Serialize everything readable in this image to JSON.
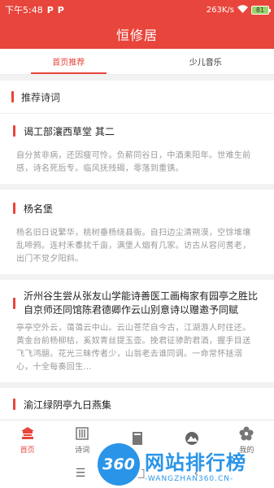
{
  "status": {
    "time": "下午5:48",
    "left_icons": [
      "P",
      "P"
    ],
    "network_speed": "263K/s",
    "battery": "81"
  },
  "app": {
    "title": "恒修居"
  },
  "tabs": [
    {
      "label": "首页推荐",
      "active": true
    },
    {
      "label": "少儿音乐",
      "active": false
    }
  ],
  "section": {
    "title": "推荐诗词"
  },
  "poems": [
    {
      "title": "谒工部瀼西草堂 其二",
      "snippet": "自分贫非病，还因瘦可怜。负薪同谷日，中酒耒阳年。世难生前感，诗名死后专。临风抚残碣，零落到重镌。"
    },
    {
      "title": "杨名堡",
      "snippet": "杨名旧日说繁华，桃树垂杨绕县衙。自扫边尘清朔漠，空馀堆壤乱啼鸦。连村禾黍扰千亩，满堡人烟有几家。访古从容问耆老，出门不觉夕阳斜。"
    },
    {
      "title": "沂州谷生尝从张友山学能诗善医工画梅家有园亭之胜比自京师还同馆陈君德卿作云山别意诗以赠邀予同赋",
      "snippet": "亭亭空外云，蔼蔼云中山。云山苍茫自今古，江湖游人时往还。黄金台前杨柳枯，奚奴青丝提玉壶。挽君征骖酌君酒，握手目送飞飞鸿翮。花光三昧传者少，山翁老去谁同调。一命常怀拯溺心，十全每奏回生..."
    },
    {
      "title": "渝江绿阴亭九日燕集",
      "snippet": ""
    }
  ],
  "bottom_nav": [
    {
      "label": "首页",
      "icon": "home-pavilion-icon",
      "active": true
    },
    {
      "label": "诗词",
      "icon": "poetry-scroll-icon",
      "active": false
    },
    {
      "label": "",
      "icon": "book-icon",
      "active": false
    },
    {
      "label": "",
      "icon": "mountain-icon",
      "active": false
    },
    {
      "label": "我的",
      "icon": "plum-blossom-icon",
      "active": false
    }
  ],
  "watermark": {
    "logo": "360",
    "cn": "网站排行榜",
    "en": "-WANGZHAN360.CN-"
  },
  "colors": {
    "primary": "#e8453c",
    "watermark": "#2a95e8"
  }
}
